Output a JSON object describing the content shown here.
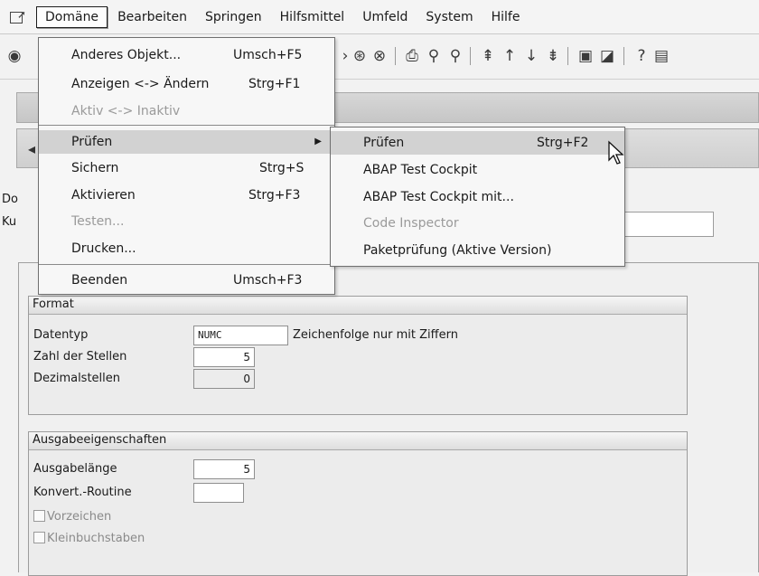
{
  "menubar": {
    "items": [
      {
        "label": "Domäne",
        "active": true
      },
      {
        "label": "Bearbeiten"
      },
      {
        "label": "Springen"
      },
      {
        "label": "Hilfsmittel"
      },
      {
        "label": "Umfeld"
      },
      {
        "label": "System"
      },
      {
        "label": "Hilfe"
      }
    ]
  },
  "toolbar_icons": [
    "save-icon",
    "back-icon",
    "exit-icon",
    "cancel-icon",
    "print-icon",
    "find-icon",
    "find-next-icon",
    "first-page-icon",
    "prev-page-icon",
    "next-page-icon",
    "last-page-icon",
    "new-session-icon",
    "shortcut-icon",
    "help-icon",
    "customize-icon"
  ],
  "header": {
    "label1": "Do",
    "label2": "Ku"
  },
  "domain_menu": {
    "items": [
      {
        "label": "Anderes Objekt...",
        "shortcut": "Umsch+F5",
        "enabled": true
      },
      {
        "label": "Anzeigen <-> Ändern",
        "shortcut": "Strg+F1",
        "enabled": true
      },
      {
        "label": "Aktiv <-> Inaktiv",
        "shortcut": "",
        "enabled": false
      },
      {
        "label": "Prüfen",
        "shortcut": "",
        "enabled": true,
        "submenu": true,
        "highlighted": true
      },
      {
        "label": "Sichern",
        "shortcut": "Strg+S",
        "enabled": true
      },
      {
        "label": "Aktivieren",
        "shortcut": "Strg+F3",
        "enabled": true
      },
      {
        "label": "Testen...",
        "shortcut": "",
        "enabled": false
      },
      {
        "label": "Drucken...",
        "shortcut": "",
        "enabled": true
      },
      {
        "label": "Beenden",
        "shortcut": "Umsch+F3",
        "enabled": true
      }
    ]
  },
  "check_submenu": {
    "items": [
      {
        "label": "Prüfen",
        "shortcut": "Strg+F2",
        "enabled": true,
        "highlighted": true
      },
      {
        "label": "ABAP Test Cockpit",
        "shortcut": "",
        "enabled": true
      },
      {
        "label": "ABAP Test Cockpit mit...",
        "shortcut": "",
        "enabled": true
      },
      {
        "label": "Code Inspector",
        "shortcut": "",
        "enabled": false
      },
      {
        "label": "Paketprüfung (Aktive Version)",
        "shortcut": "",
        "enabled": true
      }
    ]
  },
  "format": {
    "title": "Format",
    "datatype_label": "Datentyp",
    "datatype_value": "NUMC",
    "datatype_desc": "Zeichenfolge nur mit Ziffern",
    "length_label": "Zahl der Stellen",
    "length_value": "5",
    "decimals_label": "Dezimalstellen",
    "decimals_value": "0"
  },
  "output": {
    "title": "Ausgabeeigenschaften",
    "outlen_label": "Ausgabelänge",
    "outlen_value": "5",
    "conv_label": "Konvert.-Routine",
    "conv_value": "",
    "sign_label": "Vorzeichen",
    "lowercase_label": "Kleinbuchstaben"
  }
}
